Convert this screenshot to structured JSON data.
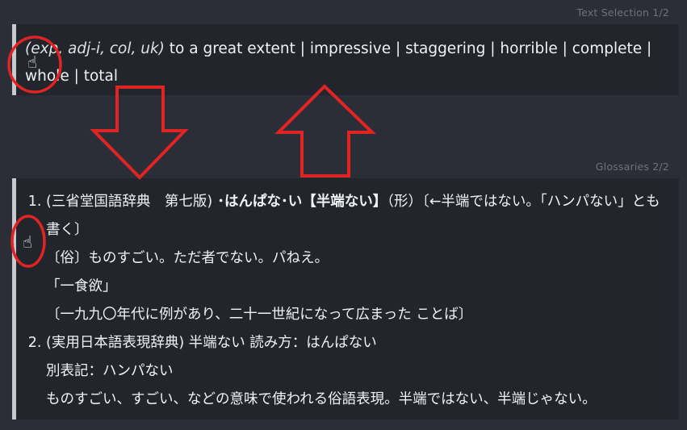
{
  "header": {
    "selection_label": "Text Selection 1/2",
    "glossary_label": "Glossaries 2/2"
  },
  "selection": {
    "pos": "(exp, adj-i, col, uk)",
    "text": " to a great extent | impressive | staggering | horrible | complete | whole | total"
  },
  "glossaries": [
    {
      "number": "1.",
      "source": "(三省堂国語辞典　第七版)",
      "headword": " ･はんぱな･い【半端ない】",
      "lines": [
        "（形）〔←半端ではない。「ハンパない」とも書く〕",
        "〔俗〕ものすごい。ただ者でない。パねえ。",
        "「一食欲」",
        "〔一九九〇年代に例があり、二十一世紀になって広まった ことば〕"
      ]
    },
    {
      "number": "2.",
      "source": "(実用日本語表現辞典)",
      "headword": " 半端ない 読み方：はんぱない",
      "lines": [
        "別表記：ハンパない",
        "ものすごい、すごい、などの意味で使われる俗語表現。半端ではない、半端じゃない。"
      ]
    }
  ],
  "colors": {
    "background": "#2b2e37",
    "panel": "#22252c",
    "annotation_red": "#e02424"
  },
  "icons": {
    "cursor": "hand-pointer-icon",
    "arrows": [
      "down-arrow-annotation",
      "up-arrow-annotation"
    ]
  }
}
